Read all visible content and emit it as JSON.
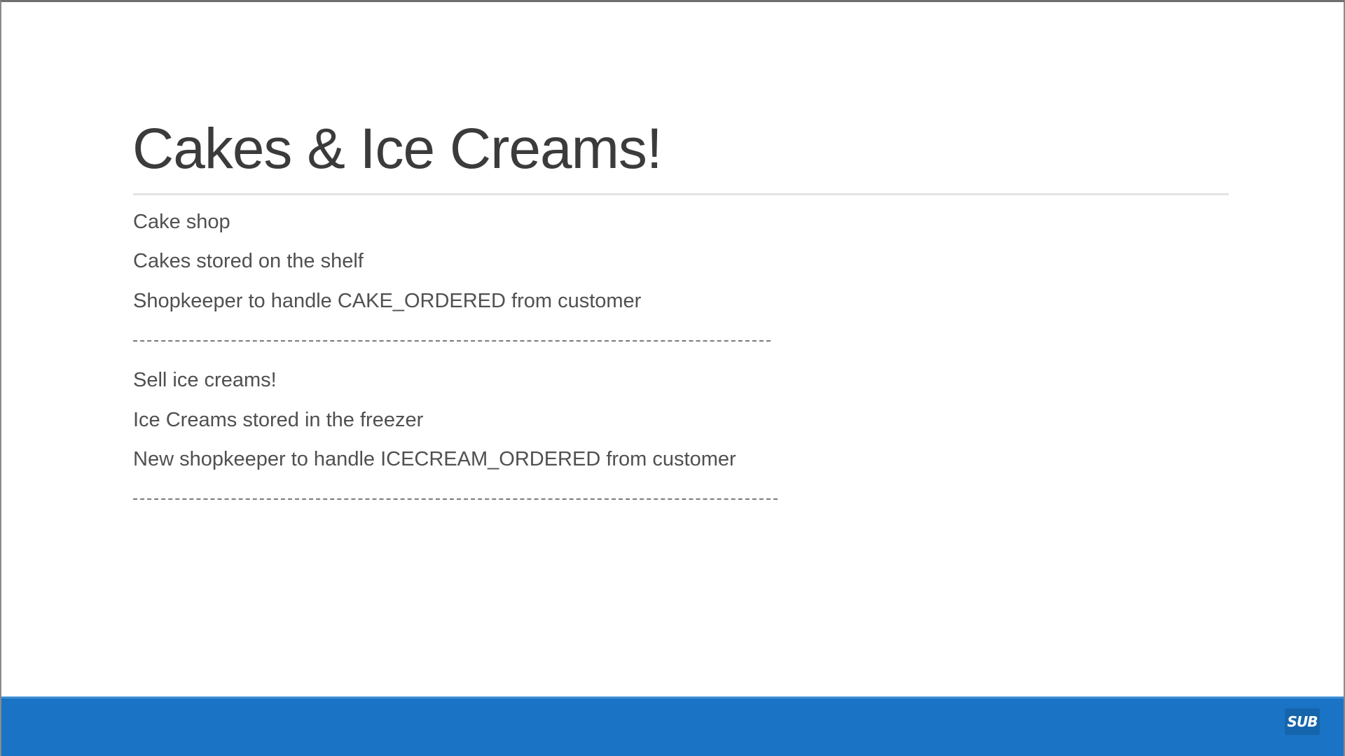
{
  "slide": {
    "title": "Cakes & Ice Creams!",
    "sections": [
      {
        "items": [
          "Cake shop",
          "Cakes stored on the shelf",
          "Shopkeeper to handle CAKE_ORDERED from customer"
        ]
      },
      {
        "items": [
          "Sell ice creams!",
          "Ice Creams stored in the freezer",
          "New shopkeeper to handle ICECREAM_ORDERED from customer"
        ]
      }
    ]
  },
  "footer": {
    "badge_label": "SUB",
    "bar_color": "#1a73c4"
  },
  "colors": {
    "title": "#3b3b3b",
    "body_text": "#505050",
    "divider": "#7a7a7a"
  }
}
